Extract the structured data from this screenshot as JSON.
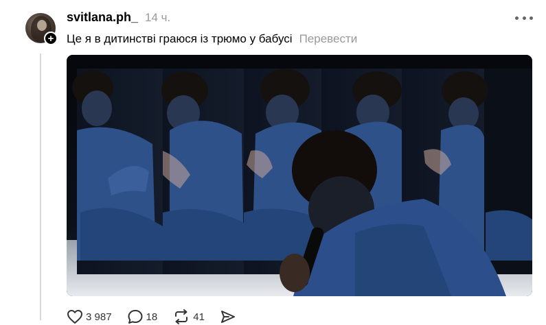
{
  "post": {
    "username": "svitlana.ph_",
    "timestamp": "14 ч.",
    "caption": "Це я в дитинстві граюся із трюмо у бабусі",
    "translate_label": "Перевести",
    "follow_badge": "+"
  },
  "media": {
    "description_icon": "video-frame"
  },
  "actions": {
    "likes": "3 987",
    "comments": "18",
    "reposts": "41"
  },
  "colors": {
    "text_primary": "#000000",
    "text_secondary": "#999999",
    "thread_line": "#d9d9d9",
    "media_dark": "#090c12",
    "denim_blue": "#2e4f8a"
  }
}
